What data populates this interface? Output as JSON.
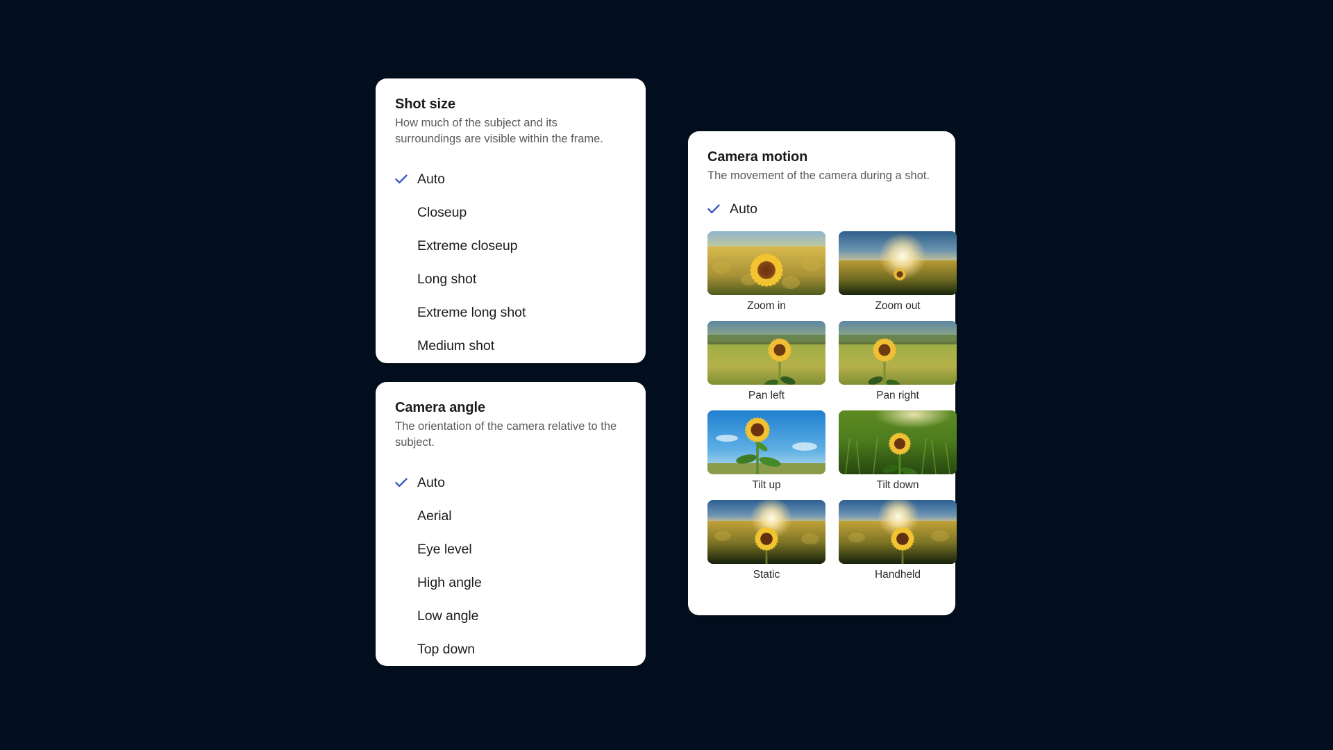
{
  "background_color": "#030f1f",
  "accent_color": "#3b5bc0",
  "cards": {
    "shot_size": {
      "title": "Shot size",
      "description": "How much of the subject and its surroundings are visible within the frame.",
      "options": [
        {
          "label": "Auto",
          "selected": true
        },
        {
          "label": "Closeup",
          "selected": false
        },
        {
          "label": "Extreme closeup",
          "selected": false
        },
        {
          "label": "Long shot",
          "selected": false
        },
        {
          "label": "Extreme long shot",
          "selected": false
        },
        {
          "label": "Medium shot",
          "selected": false
        }
      ]
    },
    "camera_angle": {
      "title": "Camera angle",
      "description": "The orientation of the camera relative to the subject.",
      "options": [
        {
          "label": "Auto",
          "selected": true
        },
        {
          "label": "Aerial",
          "selected": false
        },
        {
          "label": "Eye level",
          "selected": false
        },
        {
          "label": "High angle",
          "selected": false
        },
        {
          "label": "Low angle",
          "selected": false
        },
        {
          "label": "Top down",
          "selected": false
        }
      ]
    },
    "camera_motion": {
      "title": "Camera motion",
      "description": "The movement of the camera during a shot.",
      "auto_option": {
        "label": "Auto",
        "selected": true
      },
      "thumbnails": [
        {
          "label": "Zoom in",
          "image": "sunflower-closeup-field"
        },
        {
          "label": "Zoom out",
          "image": "sunflower-distant-sunset-field"
        },
        {
          "label": "Pan left",
          "image": "sunflower-right-of-frame-green-field"
        },
        {
          "label": "Pan right",
          "image": "sunflower-left-of-frame-green-field"
        },
        {
          "label": "Tilt up",
          "image": "sunflower-blue-sky-upward"
        },
        {
          "label": "Tilt down",
          "image": "sunflower-green-grass-downward"
        },
        {
          "label": "Static",
          "image": "sunflower-centered-sunset-field"
        },
        {
          "label": "Handheld",
          "image": "sunflower-centered-sunset-field"
        }
      ]
    }
  },
  "icons": {
    "check": "check-icon"
  }
}
